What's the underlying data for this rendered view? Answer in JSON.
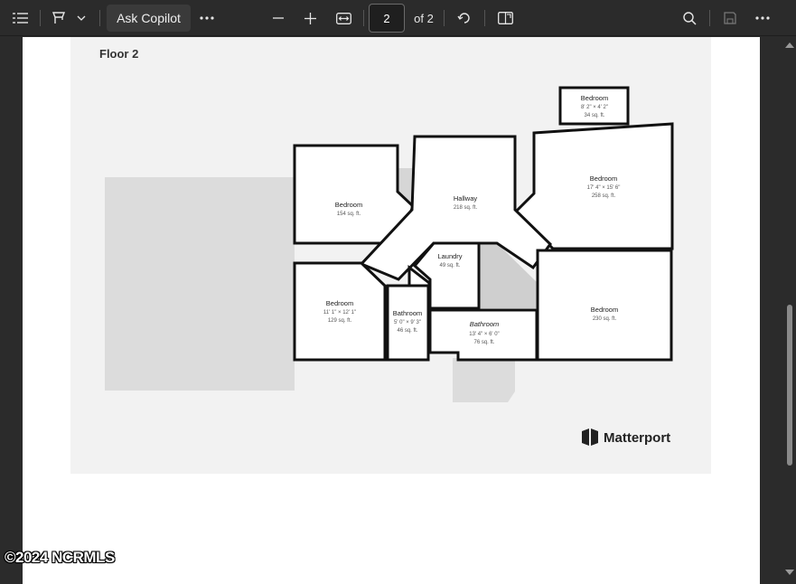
{
  "toolbar": {
    "ask_copilot": "Ask Copilot",
    "page_current": "2",
    "page_total": "of 2"
  },
  "plan": {
    "floor_title": "Floor 2",
    "rooms": [
      {
        "name": "Bedroom",
        "dims": "8' 2\" × 4' 2\"",
        "area": "34 sq. ft."
      },
      {
        "name": "Bedroom",
        "dims": "",
        "area": "154 sq. ft."
      },
      {
        "name": "Hallway",
        "dims": "",
        "area": "218 sq. ft."
      },
      {
        "name": "Bedroom",
        "dims": "17' 4\" × 15' 6\"",
        "area": "258 sq. ft."
      },
      {
        "name": "Laundry",
        "dims": "",
        "area": "49 sq. ft."
      },
      {
        "name": "Bedroom",
        "dims": "11' 1\" × 12' 1\"",
        "area": "129 sq. ft."
      },
      {
        "name": "Bathroom",
        "dims": "5' 0\" × 9' 3\"",
        "area": "46 sq. ft."
      },
      {
        "name": "Bathroom",
        "dims": "13' 4\" × 6' 0\"",
        "area": "76 sq. ft."
      },
      {
        "name": "Bedroom",
        "dims": "",
        "area": "230 sq. ft."
      }
    ],
    "logo_text": "Matterport"
  },
  "watermark": "©2024 NCRMLS",
  "icons": [
    "contents-icon",
    "draw-icon",
    "chevron-down-icon",
    "more-icon",
    "zoom-out-icon",
    "zoom-in-icon",
    "fit-width-icon",
    "rotate-icon",
    "page-view-icon",
    "search-icon",
    "save-icon",
    "more-icon"
  ]
}
